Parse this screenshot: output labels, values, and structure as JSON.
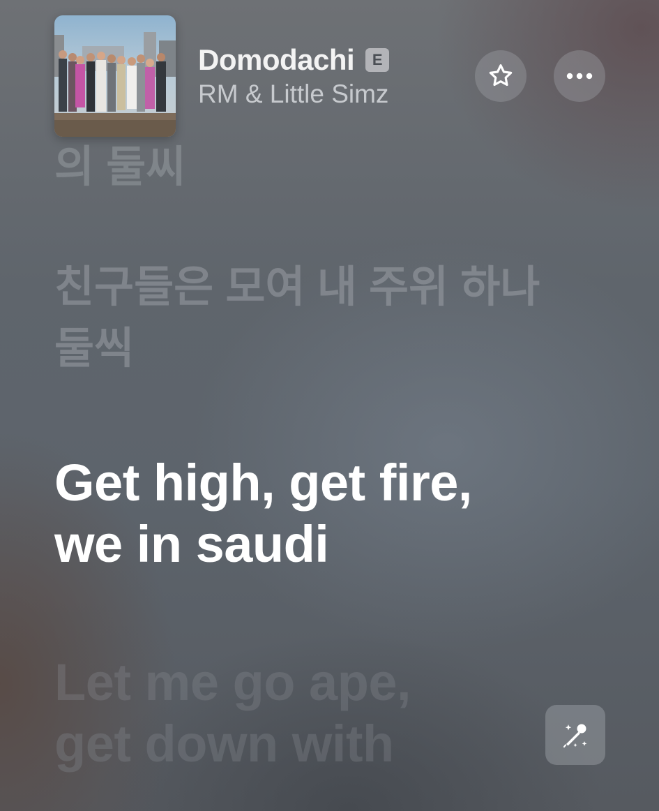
{
  "now_playing": {
    "title": "Domodachi",
    "explicit_badge": "E",
    "artist": "RM & Little Simz",
    "artwork_icon": "album-artwork"
  },
  "actions": {
    "favorite_icon": "star-icon",
    "more_icon": "ellipsis-icon",
    "sing_icon": "microphone-sparkle-icon"
  },
  "lyrics": {
    "past_partial": "의 둘씨",
    "past": "친구들은 모여 내 주위 하나둘씩",
    "current": "Get high, get fire, we in saudi",
    "next": "Let me go ape, get down with"
  },
  "colors": {
    "current_lyric": "#ffffff",
    "dim_lyric": "#bec2c8"
  }
}
